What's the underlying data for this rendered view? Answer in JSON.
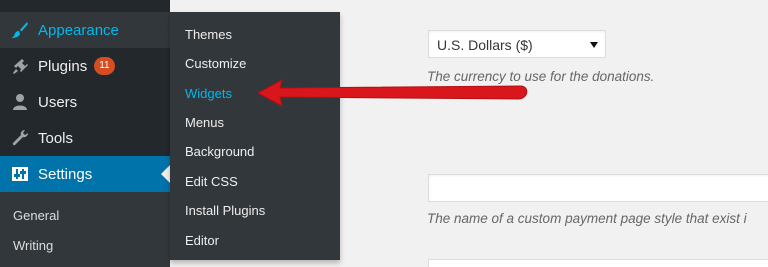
{
  "sidebar": {
    "menu": [
      {
        "label": "Appearance",
        "icon": "paintbrush-icon"
      },
      {
        "label": "Plugins",
        "icon": "plugin-icon",
        "badge": "11"
      },
      {
        "label": "Users",
        "icon": "user-icon"
      },
      {
        "label": "Tools",
        "icon": "wrench-icon"
      },
      {
        "label": "Settings",
        "icon": "settings-sliders-icon"
      }
    ],
    "settings_submenu": [
      "General",
      "Writing"
    ]
  },
  "flyout": {
    "items": [
      "Themes",
      "Customize",
      "Widgets",
      "Menus",
      "Background",
      "Edit CSS",
      "Install Plugins",
      "Editor"
    ],
    "highlighted": "Widgets"
  },
  "main": {
    "currency_select": {
      "value": "U.S. Dollars ($)"
    },
    "currency_description": "The currency to use for the donations.",
    "page_style_description": "The name of a custom payment page style that exist i"
  },
  "colors": {
    "sidebar_bg": "#23282d",
    "submenu_bg": "#32373c",
    "accent_blue": "#00b9eb",
    "settings_active": "#0073aa",
    "badge": "#d54e21",
    "annotation_arrow": "#e01f1f"
  }
}
